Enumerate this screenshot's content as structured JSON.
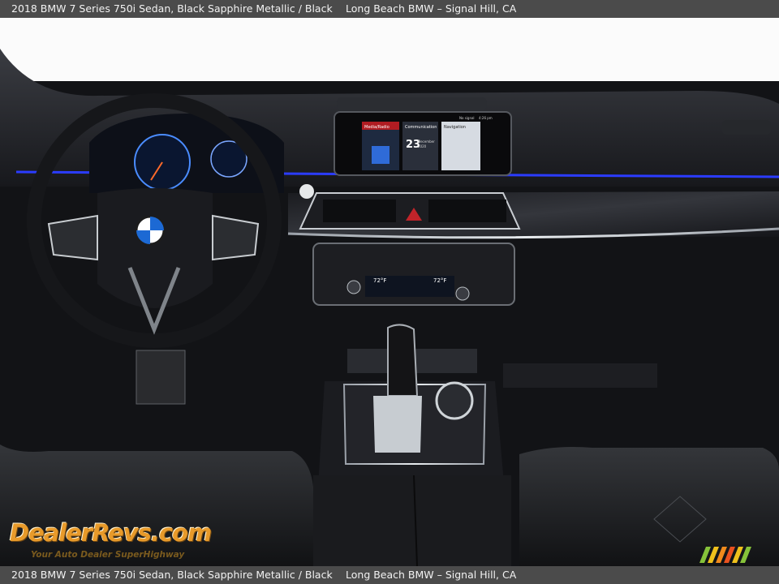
{
  "header": {
    "title": "2018 BMW 7 Series 750i Sedan,  Black Sapphire Metallic / Black",
    "dealer": "Long Beach BMW – Signal Hill,  CA"
  },
  "footer": {
    "title": "2018 BMW 7 Series 750i Sedan,  Black Sapphire Metallic / Black",
    "dealer": "Long Beach BMW – Signal Hill,  CA"
  },
  "watermark": {
    "logo": "DealerRevs.com",
    "tagline": "Your Auto Dealer SuperHighway"
  },
  "infotainment": {
    "tile_1": "Media/Radio",
    "tile_2": "Communication",
    "tile_3": "Navigation",
    "date_day": "23",
    "date_month": "December",
    "date_year": "2020",
    "status": "No signal",
    "time": "4:26 pm"
  },
  "climate": {
    "left_temp": "72°F",
    "right_temp": "72°F"
  },
  "colors": {
    "info_bar_bg": "#4b4b4b",
    "info_bar_text": "#f2f2f2",
    "interior_black": "#121316",
    "ambient_blue": "#2b3cff",
    "watermark_orange": "#e89a2a"
  }
}
